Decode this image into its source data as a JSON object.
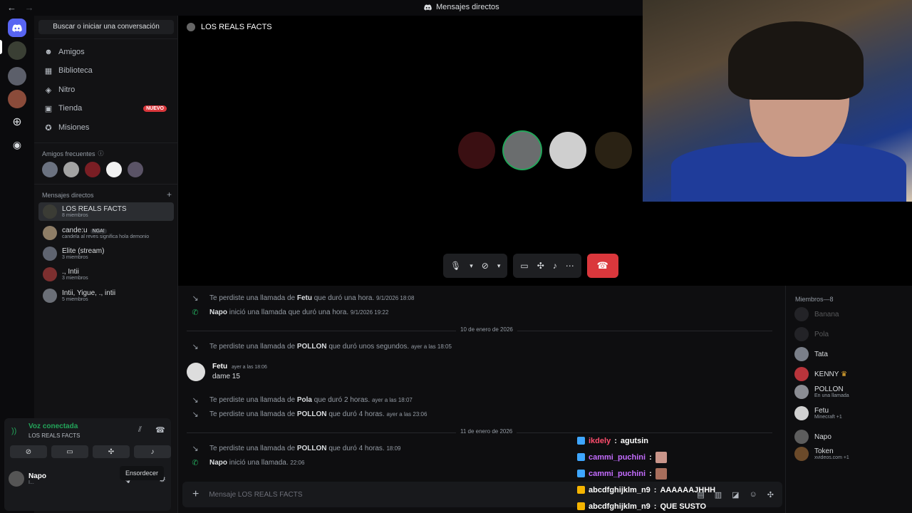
{
  "topbar": {
    "back": "←",
    "forward": "→",
    "title": "Mensajes directos"
  },
  "sidebar": {
    "search_label": "Buscar o iniciar una conversación",
    "nav": [
      {
        "label": "Amigos",
        "icon": "friends-icon"
      },
      {
        "label": "Biblioteca",
        "icon": "library-icon"
      },
      {
        "label": "Nitro",
        "icon": "nitro-icon"
      },
      {
        "label": "Tienda",
        "icon": "shop-icon",
        "badge": "NUEVO"
      },
      {
        "label": "Misiones",
        "icon": "quests-icon"
      }
    ],
    "frequent_label": "Amigos frecuentes",
    "dm_label": "Mensajes directos",
    "dms": [
      {
        "name": "LOS REALS FACTS",
        "sub": "8 miembros"
      },
      {
        "name": "cande:u",
        "tag": "NGA!",
        "sub": "candela al reves significa hola demonio"
      },
      {
        "name": "Elite (stream)",
        "sub": "3 miembros"
      },
      {
        "name": "., Intii",
        "sub": "3 miembros"
      },
      {
        "name": "Intii, Yigue, ., intii",
        "sub": "5 miembros"
      }
    ]
  },
  "voice": {
    "status": "Voz conectada",
    "channel": "LOS REALS FACTS",
    "user_name": "Napo",
    "user_status": "I...",
    "tooltip": "Ensordecer"
  },
  "main": {
    "channel_name": "LOS REALS FACTS"
  },
  "chat": {
    "messages": [
      {
        "pre": "Te perdiste una llamada de",
        "who": "Fetu",
        "post": "que duró una hora.",
        "ts": "9/1/2026 18:08",
        "icon": "missed"
      },
      {
        "pre": "",
        "who": "Napo",
        "post": "inició una llamada que duró una hora.",
        "ts": "9/1/2026 19:22",
        "icon": "started"
      },
      {
        "pre": "Te perdiste una llamada de",
        "who": "POLLON",
        "post": "que duró unos segundos.",
        "ts": "ayer a las 18:05",
        "icon": "missed"
      },
      {
        "pre": "Te perdiste una llamada de",
        "who": "Pola",
        "post": "que duró 2 horas.",
        "ts": "ayer a las 18:07",
        "icon": "missed"
      },
      {
        "pre": "Te perdiste una llamada de",
        "who": "POLLON",
        "post": "que duró 4 horas.",
        "ts": "ayer a las 23:06",
        "icon": "missed"
      },
      {
        "pre": "Te perdiste una llamada de",
        "who": "POLLON",
        "post": "que duró 4 horas.",
        "ts": "18:09",
        "icon": "missed"
      },
      {
        "pre": "",
        "who": "Napo",
        "post": "inició una llamada.",
        "ts": "22:06",
        "icon": "started"
      }
    ],
    "date1": "10 de enero de 2026",
    "date2": "11 de enero de 2026",
    "fetu_name": "Fetu",
    "fetu_ts": "ayer a las 18:06",
    "fetu_text": "dame 15",
    "placeholder": "Mensaje LOS REALS FACTS"
  },
  "overlay": [
    {
      "user": "ikdely",
      "msg": "agutsin",
      "color": "#ff4d6d",
      "plat": "#3ea6ff"
    },
    {
      "user": "cammi_puchini",
      "msg": "",
      "color": "#c46cff",
      "plat": "#3ea6ff"
    },
    {
      "user": "cammi_puchini",
      "msg": "",
      "color": "#c46cff",
      "plat": "#3ea6ff"
    },
    {
      "user": "abcdfghijklm_n9",
      "msg": "AAAAAAJHHH",
      "color": "#ffffff",
      "plat": "#f5b400"
    },
    {
      "user": "abcdfghijklm_n9",
      "msg": "QUE SUSTO",
      "color": "#ffffff",
      "plat": "#f5b400"
    }
  ],
  "members": {
    "header": "Miembros—8",
    "list": [
      {
        "name": "Banana",
        "sub": "",
        "offline": true
      },
      {
        "name": "Pola",
        "sub": "",
        "offline": true
      },
      {
        "name": "Tata",
        "sub": "",
        "offline": false
      },
      {
        "name": "KENNY",
        "sub": "",
        "offline": false,
        "crown": "♛"
      },
      {
        "name": "POLLON",
        "sub": "En una llamada",
        "offline": false
      },
      {
        "name": "Fetu",
        "sub": "Minecraft +1",
        "offline": false
      },
      {
        "name": "Napo",
        "sub": "",
        "offline": false
      },
      {
        "name": "Token",
        "sub": "xvideos.com +1",
        "offline": false
      }
    ]
  },
  "colors": {
    "accent": "#5865f2",
    "green": "#23a55a",
    "danger": "#da373c"
  }
}
